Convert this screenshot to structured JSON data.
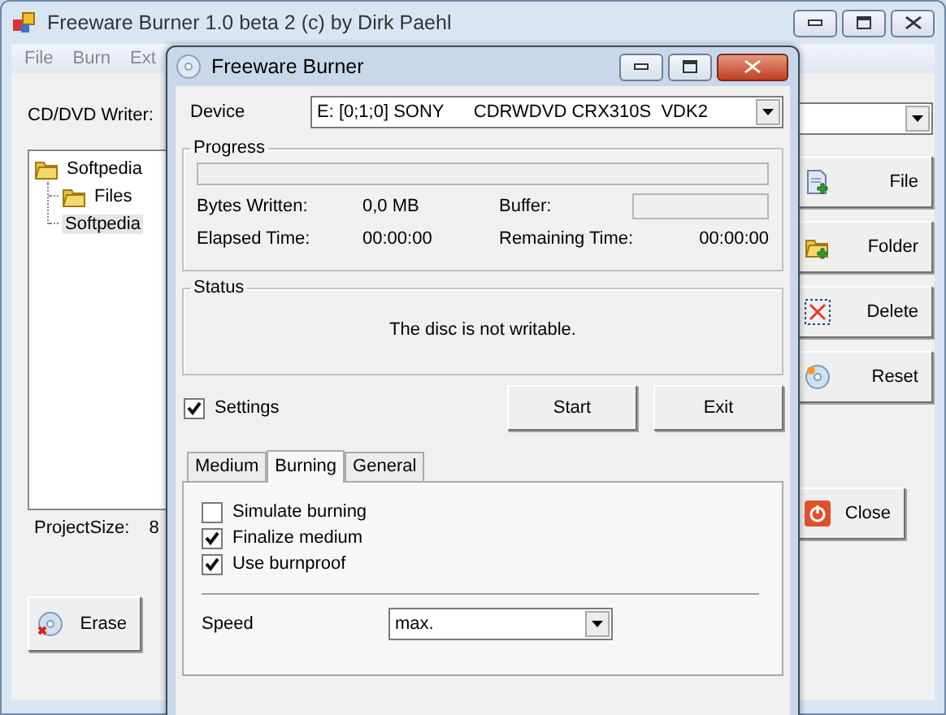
{
  "main_window": {
    "title": "Freeware Burner 1.0 beta 2 (c) by Dirk Paehl",
    "menu": [
      "File",
      "Burn",
      "Ext"
    ],
    "writer_label": "CD/DVD Writer:",
    "tree": [
      {
        "label": "Softpedia",
        "kind": "folder",
        "selected": false,
        "children": [
          {
            "label": "Files",
            "kind": "folder",
            "selected": false
          },
          {
            "label": "Softpedia",
            "kind": "file",
            "selected": true
          }
        ]
      }
    ],
    "project_size_label": "ProjectSize:",
    "project_size_value": "8",
    "erase_button": "Erase",
    "side_buttons": [
      {
        "label": "File",
        "kind": "add-file"
      },
      {
        "label": "Folder",
        "kind": "add-folder"
      },
      {
        "label": "Delete",
        "kind": "delete"
      },
      {
        "label": "Reset",
        "kind": "reset"
      }
    ],
    "close_button": "Close"
  },
  "dialog": {
    "title": "Freeware Burner",
    "device_label": "Device",
    "device_value": "E: [0;1;0] SONY      CDRWDVD CRX310S  VDK2",
    "progress": {
      "title": "Progress",
      "level": 0,
      "bytes_written_label": "Bytes Written:",
      "bytes_written": "0,0 MB",
      "buffer": {
        "label": "Buffer:",
        "level": 0
      },
      "elapsed_label": "Elapsed Time:",
      "elapsed": "00:00:00",
      "remaining_label": "Remaining Time:",
      "remaining": "00:00:00"
    },
    "status": {
      "title": "Status",
      "message": "The disc is not writable."
    },
    "settings": {
      "label": "Settings",
      "checked": true
    },
    "buttons": [
      "Start",
      "Exit"
    ],
    "tabs": [
      {
        "label": "Medium",
        "selected": false
      },
      {
        "label": "Burning",
        "selected": true
      },
      {
        "label": "General",
        "selected": false
      }
    ],
    "options": [
      {
        "label": "Simulate burning",
        "checked": false
      },
      {
        "label": "Finalize medium",
        "checked": true
      },
      {
        "label": "Use burnproof",
        "checked": true
      }
    ],
    "speed_label": "Speed",
    "speed_value": "max."
  }
}
